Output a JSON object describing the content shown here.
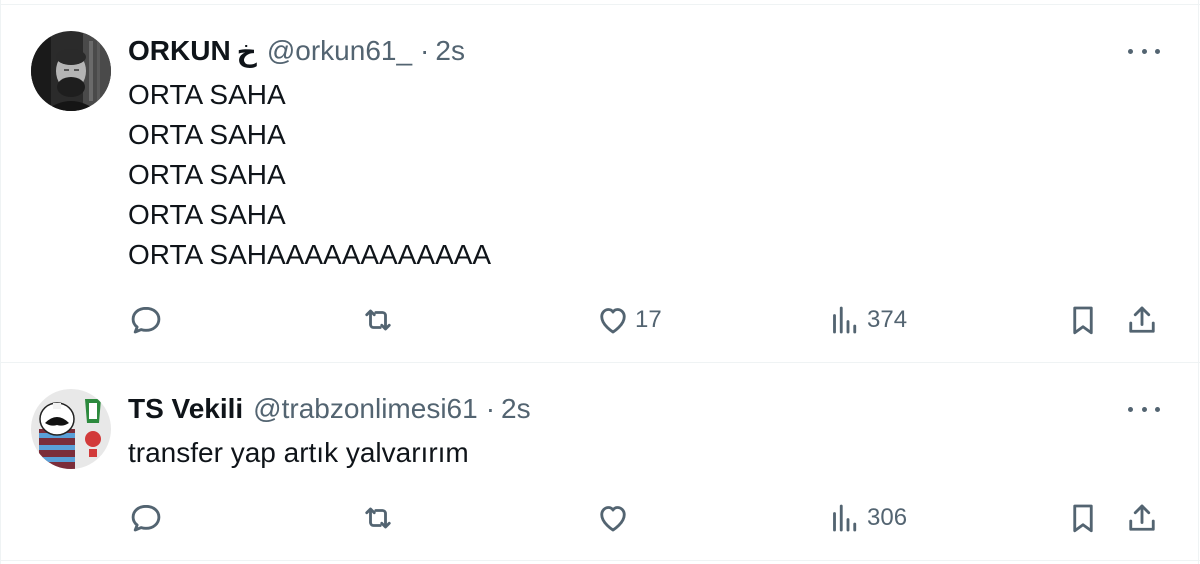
{
  "tweets": [
    {
      "name": "ORKUN",
      "name_emoji": "خ",
      "handle": "@orkun61_",
      "separator": "·",
      "time": "2s",
      "lines": [
        "ORTA SAHA",
        "ORTA SAHA",
        "ORTA SAHA",
        "ORTA SAHA",
        "ORTA SAHAAAAAAAAAAAA"
      ],
      "actions": {
        "reply_count": "",
        "retweet_count": "",
        "like_count": "17",
        "views_count": "374"
      }
    },
    {
      "name": "TS Vekili",
      "handle": "@trabzonlimesi61",
      "separator": "·",
      "time": "2s",
      "lines": [
        "transfer yap artık yalvarırım"
      ],
      "actions": {
        "reply_count": "",
        "retweet_count": "",
        "like_count": "",
        "views_count": "306"
      }
    }
  ],
  "colors": {
    "text": "#0f1419",
    "secondary": "#536471",
    "border": "#eff3f4",
    "background": "#ffffff"
  },
  "icons": [
    "reply-icon",
    "retweet-icon",
    "like-icon",
    "views-icon",
    "bookmark-icon",
    "share-icon",
    "more-icon"
  ]
}
